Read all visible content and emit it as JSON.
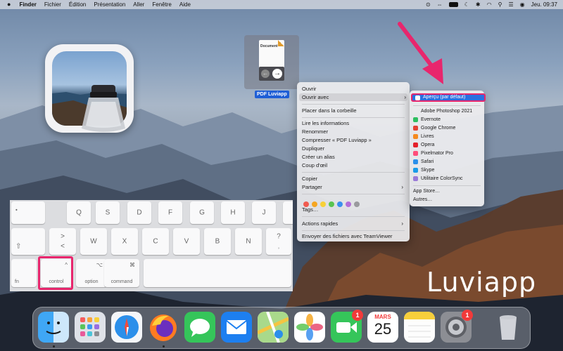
{
  "menubar": {
    "apple_icon": "apple-icon",
    "items": [
      "Finder",
      "Fichier",
      "Édition",
      "Présentation",
      "Aller",
      "Fenêtre",
      "Aide"
    ],
    "clock": "Jeu. 09:37"
  },
  "file": {
    "name": "PDF Luviapp",
    "thumb_title": "Document"
  },
  "context_menu": {
    "items": [
      {
        "label": "Ouvrir"
      },
      {
        "label": "Ouvrir avec"
      },
      {
        "label": "Placer dans la corbeille"
      },
      {
        "label": "Lire les informations"
      },
      {
        "label": "Renommer"
      },
      {
        "label": "Compresser « PDF Luviapp »"
      },
      {
        "label": "Dupliquer"
      },
      {
        "label": "Créer un alias"
      },
      {
        "label": "Coup d'œil"
      },
      {
        "label": "Copier"
      },
      {
        "label": "Partager"
      },
      {
        "label": "Tags…"
      },
      {
        "label": "Actions rapides"
      },
      {
        "label": "Envoyer des fichiers avec TeamViewer"
      }
    ],
    "tag_colors": [
      "#f05a4f",
      "#f5a623",
      "#f7d038",
      "#5ac451",
      "#3b8fef",
      "#b26ed9",
      "#9a9a9e"
    ]
  },
  "submenu": {
    "default_app": "Aperçu (par défaut)",
    "apps": [
      {
        "label": "Adobe Photoshop 2021",
        "color": "#e9e9ec"
      },
      {
        "label": "Evernote",
        "color": "#2dbe60"
      },
      {
        "label": "Google Chrome",
        "color": "#e34133"
      },
      {
        "label": "Livres",
        "color": "#f58a1f"
      },
      {
        "label": "Opera",
        "color": "#e4212b"
      },
      {
        "label": "Pixelmator Pro",
        "color": "#ff4d7a"
      },
      {
        "label": "Safari",
        "color": "#2b8fea"
      },
      {
        "label": "Skype",
        "color": "#1a9be8"
      },
      {
        "label": "Utilitaire ColorSync",
        "color": "#9a7ad8"
      }
    ],
    "app_store": "App Store…",
    "others": "Autres…"
  },
  "keyboard": {
    "row1": [
      "•",
      "Q",
      "S",
      "D",
      "F",
      "G",
      "H",
      "J",
      "K"
    ],
    "row2": [
      "⇧",
      ">",
      "<",
      "W",
      "X",
      "C",
      "V",
      "B",
      "N",
      "?"
    ],
    "row2_sub": [
      ",",
      "!"
    ],
    "bottom": {
      "fn": "fn",
      "control": "control",
      "control_sym": "^",
      "option": "option",
      "option_sym": "⌥",
      "command": "command",
      "command_sym": "⌘"
    }
  },
  "watermark": "Luviapp",
  "dock": {
    "apps": [
      "Finder",
      "Launchpad",
      "Safari",
      "Firefox",
      "Messages",
      "Mail",
      "Plans",
      "Photos",
      "FaceTime",
      "Calendrier",
      "Notes",
      "Préférences Système",
      "Corbeille"
    ],
    "facetime_badge": "1",
    "prefs_badge": "1",
    "calendar_month": "MARS",
    "calendar_day": "25"
  }
}
